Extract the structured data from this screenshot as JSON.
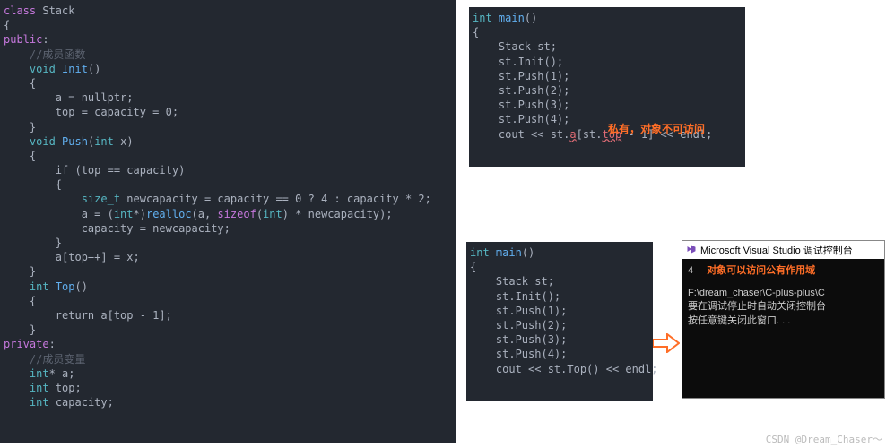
{
  "left": {
    "l1a": "class",
    "l1b": " Stack",
    "l2": "{",
    "l3a": "public",
    "l3b": ":",
    "l4": "    //成员函数",
    "l5a": "    ",
    "l5b": "void",
    "l5c": " ",
    "l5d": "Init",
    "l5e": "()",
    "l6": "    {",
    "l7": "        a = nullptr;",
    "l8": "        top = capacity = 0;",
    "l9": "    }",
    "l10a": "    ",
    "l10b": "void",
    "l10c": " ",
    "l10d": "Push",
    "l10e": "(",
    "l10f": "int",
    "l10g": " x)",
    "l11": "    {",
    "l12": "        if (top == capacity)",
    "l13": "        {",
    "l14a": "            ",
    "l14b": "size_t",
    "l14c": " newcapacity = capacity == 0 ? 4 : capacity * 2;",
    "l15a": "            a = (",
    "l15b": "int",
    "l15c": "*)",
    "l15d": "realloc",
    "l15e": "(a, ",
    "l15f": "sizeof",
    "l15g": "(",
    "l15h": "int",
    "l15i": ") * newcapacity);",
    "l16": "            capacity = newcapacity;",
    "l17": "        }",
    "l18": "        a[top++] = x;",
    "l19": "    }",
    "l20a": "    ",
    "l20b": "int",
    "l20c": " ",
    "l20d": "Top",
    "l20e": "()",
    "l21": "    {",
    "l22": "        return a[top - 1];",
    "l23": "    }",
    "l24a": "private",
    "l24b": ":",
    "l25": "    //成员变量",
    "l26a": "    ",
    "l26b": "int",
    "l26c": "* a;",
    "l27a": "    ",
    "l27b": "int",
    "l27c": " top;",
    "l28a": "    ",
    "l28b": "int",
    "l28c": " capacity;"
  },
  "m1": {
    "l1a": "int",
    "l1b": " ",
    "l1c": "main",
    "l1d": "()",
    "l2": "{",
    "l3": "    Stack st;",
    "l4": "    st.Init();",
    "l5": "    st.Push(1);",
    "l6": "    st.Push(2);",
    "l7": "    st.Push(3);",
    "l8": "    st.Push(4);",
    "l9a": "    cout << st.",
    "l9b": "a",
    "l9c": "[st.",
    "l9d": "top",
    "l9e": " - 1] << endl;"
  },
  "m2": {
    "l1a": "int",
    "l1b": " ",
    "l1c": "main",
    "l1d": "()",
    "l2": "{",
    "l3": "    Stack st;",
    "l4": "    st.Init();",
    "l5": "    st.Push(1);",
    "l6": "    st.Push(2);",
    "l7": "    st.Push(3);",
    "l8": "    st.Push(4);",
    "l9": "    cout << st.Top() << endl;"
  },
  "anno1": "私有，对象不可访问",
  "anno2": "对象可以访问公有作用域",
  "console": {
    "title": "Microsoft Visual Studio 调试控制台",
    "out": "4",
    "path": "F:\\dream_chaser\\C-plus-plus\\C",
    "msg1": "要在调试停止时自动关闭控制台",
    "msg2": "按任意键关闭此窗口. . ."
  },
  "wm": "CSDN @Dream_Chaser～"
}
